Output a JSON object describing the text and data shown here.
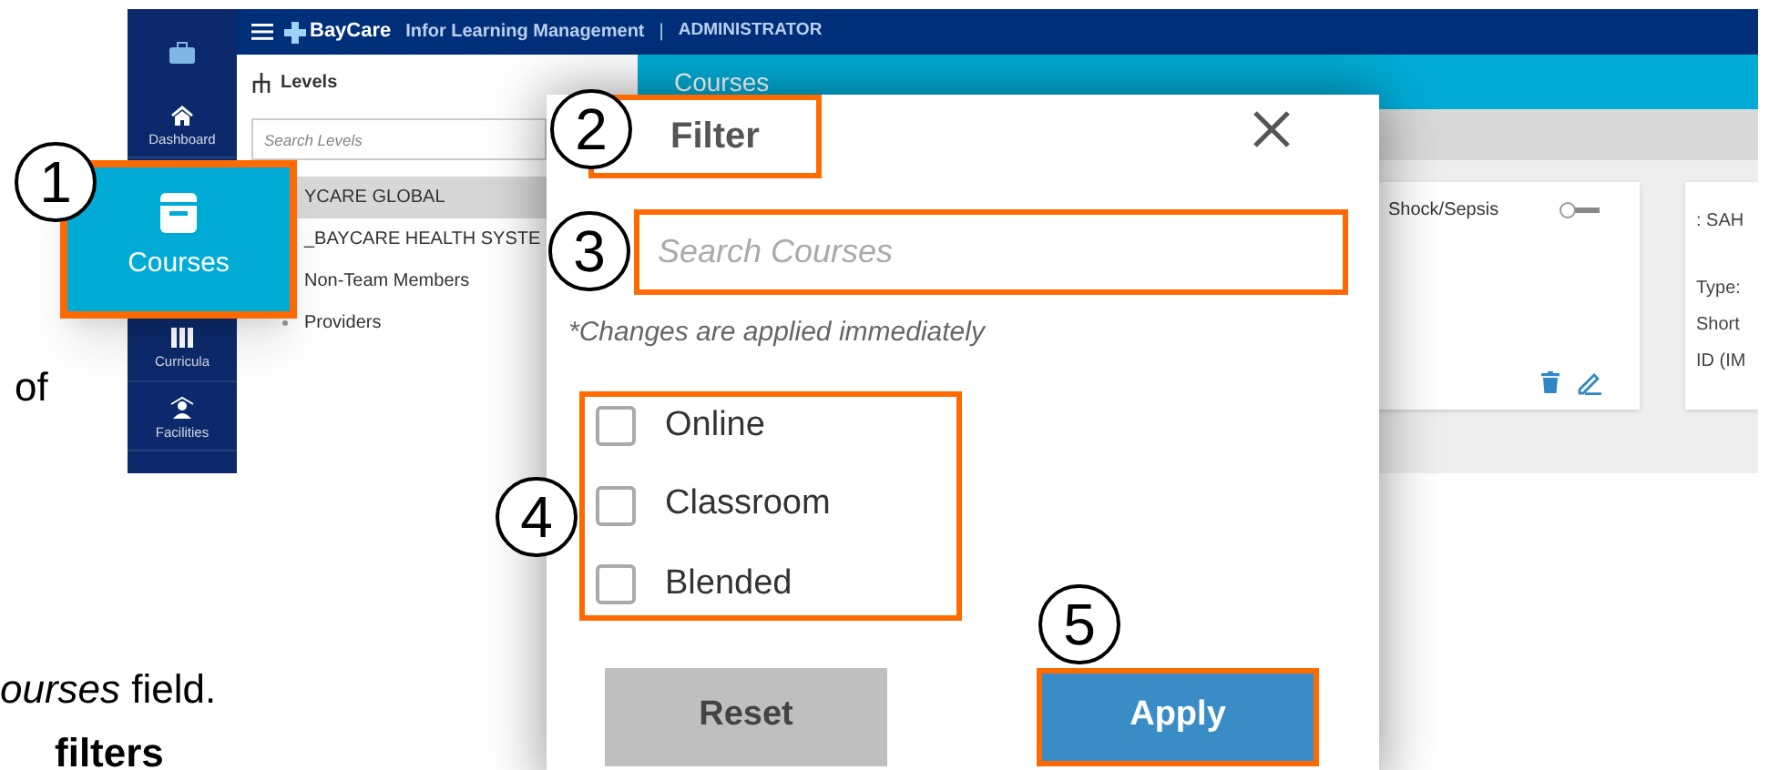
{
  "document": {
    "fragments": [
      {
        "kind": "plain",
        "text": "of"
      },
      {
        "kind": "plain",
        "text": "*ourses* field."
      },
      {
        "kind": "bold",
        "text": "filters"
      }
    ]
  },
  "app": {
    "header": {
      "brand": "BayCare",
      "title": "Infor Learning Management",
      "separator": "|",
      "role": "ADMINISTRATOR"
    },
    "nav": [
      {
        "label": "Dashboard"
      },
      {
        "label": "Curricula"
      },
      {
        "label": "Facilities"
      }
    ],
    "levels_panel": {
      "title": "Levels",
      "search": {
        "placeholder": "Search Levels"
      },
      "items": [
        {
          "label": "YCARE GLOBAL",
          "selected": true,
          "kind": "node"
        },
        {
          "label": "_BAYCARE HEALTH SYSTE",
          "selected": false,
          "kind": "node"
        },
        {
          "label": "Non-Team Members",
          "selected": false,
          "kind": "node"
        },
        {
          "label": "Providers",
          "selected": false,
          "kind": "leaf"
        }
      ]
    },
    "page_title": "Courses",
    "cards": [
      {
        "title": "Shock/Sepsis",
        "on": false
      },
      {
        "lines": [
          ": SAH",
          "Type:",
          "Short",
          "ID (IM"
        ]
      }
    ]
  },
  "courses_tile": {
    "label": "Courses"
  },
  "filter_dialog": {
    "title": "Filter",
    "search": {
      "placeholder": "Search Courses"
    },
    "note": "*Changes are applied immediately",
    "options": [
      {
        "label": "Online",
        "checked": false
      },
      {
        "label": "Classroom",
        "checked": false
      },
      {
        "label": "Blended",
        "checked": false
      }
    ],
    "buttons": [
      {
        "label": "Reset",
        "kind": "secondary"
      },
      {
        "label": "Apply",
        "kind": "primary"
      }
    ]
  },
  "callouts": [
    "1",
    "2",
    "3",
    "4",
    "5"
  ]
}
